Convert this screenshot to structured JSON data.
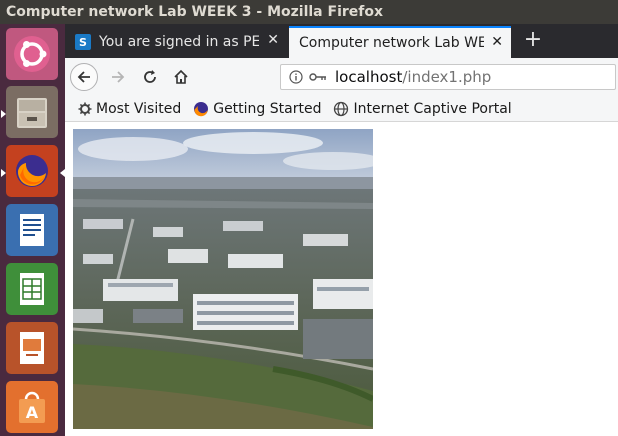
{
  "window": {
    "title": "Computer network Lab WEEK 3 - Mozilla Firefox"
  },
  "launcher": {
    "items": [
      {
        "name": "ubuntu-dash-icon"
      },
      {
        "name": "files-icon"
      },
      {
        "name": "firefox-icon"
      },
      {
        "name": "writer-icon"
      },
      {
        "name": "calc-icon"
      },
      {
        "name": "impress-icon"
      },
      {
        "name": "software-center-icon"
      }
    ]
  },
  "tabs": [
    {
      "label": "You are signed in as PES",
      "favicon": "S",
      "active": false
    },
    {
      "label": "Computer network Lab WEE",
      "active": true
    }
  ],
  "navbar": {
    "url_host": "localhost",
    "url_path": "/index1.php"
  },
  "bookmarks": [
    {
      "label": "Most Visited",
      "icon": "gear-icon"
    },
    {
      "label": "Getting Started",
      "icon": "firefox-icon"
    },
    {
      "label": "Internet Captive Portal",
      "icon": "globe-icon"
    }
  ],
  "colors": {
    "titlebar": "#3c3b37",
    "launcher": "#4a2a3f",
    "tab_accent": "#0a84ff"
  }
}
